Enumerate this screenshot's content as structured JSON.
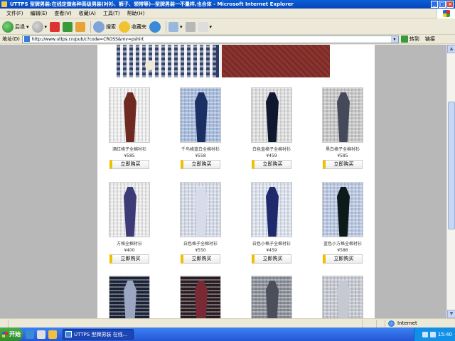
{
  "window": {
    "title": "UTTPS 型牌男装:在线定做各种高级男装(衬衫、裤子、领带等)--型牌男装一不量样,也合体 - Microsoft Internet Explorer",
    "controls": [
      "_",
      "□",
      "×"
    ]
  },
  "menu": [
    "文件(F)",
    "编辑(E)",
    "查看(V)",
    "收藏(A)",
    "工具(T)",
    "帮助(H)"
  ],
  "toolbar": {
    "back": "后退",
    "search": "搜索",
    "favorites": "收藏夹"
  },
  "address": {
    "label": "地址(D)",
    "url": "http://www.uttps.cn/pub/c?code=CROSS&mv=pshirt",
    "go": "转到",
    "links": "链接"
  },
  "products": [
    {
      "name": "酒红格子全棉衬衫",
      "price": "¥585",
      "buy": "立即购买",
      "bg": "#f0f0f0",
      "tie": "#6e2a22"
    },
    {
      "name": "千鸟格蓝白全棉衬衫",
      "price": "¥558",
      "buy": "立即购买",
      "bg": "#a8bde0",
      "tie": "#1c2f62"
    },
    {
      "name": "白色直格子全棉衬衫",
      "price": "¥459",
      "buy": "立即购买",
      "bg": "#e0e0e0",
      "tie": "#101830"
    },
    {
      "name": "黑白格子全棉衬衫",
      "price": "¥585",
      "buy": "立即购买",
      "bg": "#c8c8c8",
      "tie": "#444a5a"
    },
    {
      "name": "方格全棉衬衫",
      "price": "¥400",
      "buy": "立即购买",
      "bg": "#ececec",
      "tie": "#3d3a78"
    },
    {
      "name": "白色格子全棉衬衫",
      "price": "¥550",
      "buy": "立即购买",
      "bg": "#d6dcea",
      "tie": "#d6dcea"
    },
    {
      "name": "白色小格子全棉衬衫",
      "price": "¥459",
      "buy": "立即购买",
      "bg": "#dde3ef",
      "tie": "#1e2a6b"
    },
    {
      "name": "蓝色小方格全棉衬衫",
      "price": "¥586",
      "buy": "立即购买",
      "bg": "#b9c8e4",
      "tie": "#0d1a1a"
    }
  ],
  "partial_products": [
    {
      "bg": "#1a2338",
      "tie": "#9aa6c2"
    },
    {
      "bg": "#2a1c22",
      "tie": "#7a2a35"
    },
    {
      "bg": "#8b8f98",
      "tie": "#4b4f5a"
    },
    {
      "bg": "#c6c9d2",
      "tie": "#c6c9d2"
    }
  ],
  "status": {
    "zone": "Internet"
  },
  "taskbar": {
    "start": "开始",
    "task": "UTTPS 型牌男装 在线...",
    "clock": "15:40"
  }
}
